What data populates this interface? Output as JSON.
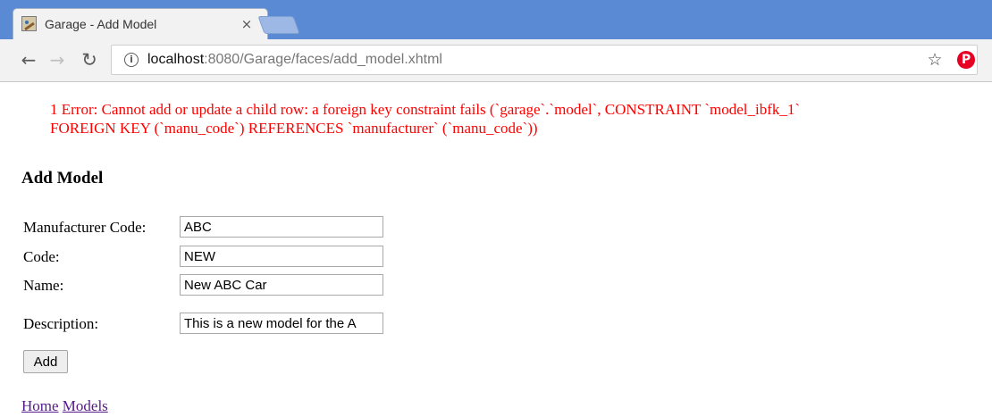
{
  "browser": {
    "tab_title": "Garage - Add Model",
    "tab_close": "×",
    "url_host": "localhost",
    "url_rest": ":8080/Garage/faces/add_model.xhtml",
    "accent_color": "#5b8ad5"
  },
  "page": {
    "errors": [
      "1 Error: Cannot add or update a child row: a foreign key constraint fails (`garage`.`model`, CONSTRAINT `model_ibfk_1`",
      "FOREIGN KEY (`manu_code`) REFERENCES `manufacturer` (`manu_code`))"
    ],
    "error_color": "#ff0000",
    "heading": "Add Model",
    "form": {
      "manufacturer_code": {
        "label": "Manufacturer Code:",
        "value": "ABC"
      },
      "code": {
        "label": "Code:",
        "value": "NEW"
      },
      "name": {
        "label": "Name:",
        "value": "New ABC Car"
      },
      "description": {
        "label": "Description:",
        "value": "This is a new model for the A"
      }
    },
    "add_button": "Add",
    "links": {
      "home": "Home",
      "models": "Models"
    }
  }
}
